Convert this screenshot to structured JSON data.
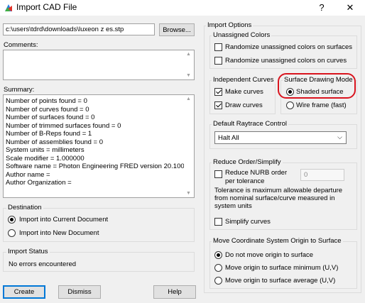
{
  "window": {
    "title": "Import CAD File",
    "help_label": "?",
    "close_label": "✕"
  },
  "file": {
    "path": "c:\\users\\tdrd\\downloads\\luxeon z es.stp",
    "browse_label": "Browse..."
  },
  "comments": {
    "label": "Comments:",
    "value": ""
  },
  "summary": {
    "label": "Summary:",
    "lines": [
      "Number of points found = 0",
      "Number of curves found = 0",
      "Number of surfaces found = 0",
      "Number of trimmed surfaces found = 0",
      "Number of B-Reps found = 1",
      "Number of assemblies found = 0",
      "System units = millimeters",
      "Scale modifier = 1.000000",
      "Software name = Photon Engineering FRED version 20.100",
      "Author name =",
      "Author Organization ="
    ]
  },
  "destination": {
    "label": "Destination",
    "options": [
      "Import into Current Document",
      "Import into New Document"
    ],
    "selected": 0
  },
  "import_status": {
    "label": "Import Status",
    "message": "No errors encountered"
  },
  "buttons": {
    "create": "Create",
    "dismiss": "Dismiss",
    "help": "Help"
  },
  "import_options": {
    "label": "Import Options",
    "unassigned_colors": {
      "label": "Unassigned Colors",
      "surfaces_label": "Randomize unassigned colors on surfaces",
      "surfaces_checked": false,
      "curves_label": "Randomize unassigned colors on curves",
      "curves_checked": false
    },
    "independent_curves": {
      "label": "Independent Curves",
      "make_curves_label": "Make curves",
      "make_curves_checked": true,
      "draw_curves_label": "Draw curves",
      "draw_curves_checked": true
    },
    "surface_drawing_mode": {
      "label": "Surface Drawing Mode",
      "options": [
        "Shaded surface",
        "Wire frame (fast)"
      ],
      "selected": 0,
      "highlight_color": "#d9141e"
    },
    "raytrace_control": {
      "label": "Default Raytrace Control",
      "selected": "Halt All"
    },
    "reduce_order": {
      "label": "Reduce Order/Simplify",
      "reduce_nurb_line1": "Reduce NURB order",
      "reduce_nurb_line2": "per tolerance",
      "reduce_checked": false,
      "tolerance_value": "0",
      "description": "Tolerance is maximum allowable departure from nominal surface/curve measured in system units",
      "simplify_label": "Simplify curves",
      "simplify_checked": false
    },
    "move_origin": {
      "label": "Move Coordinate System Origin to Surface",
      "options": [
        "Do not move origin to surface",
        "Move origin to surface minimum (U,V)",
        "Move origin to surface average (U,V)"
      ],
      "selected": 0
    }
  }
}
